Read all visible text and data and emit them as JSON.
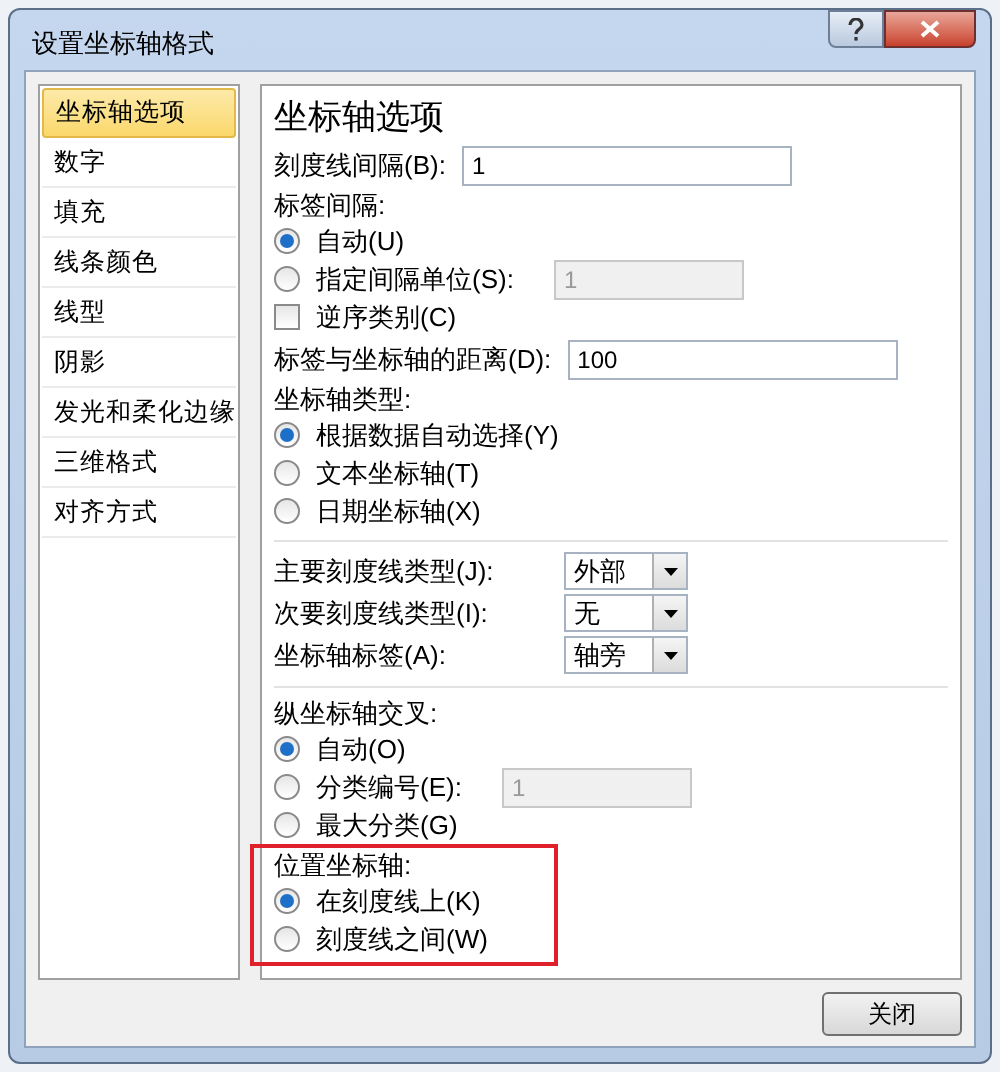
{
  "window": {
    "title": "设置坐标轴格式"
  },
  "sidebar": {
    "items": [
      {
        "label": "坐标轴选项",
        "selected": true
      },
      {
        "label": "数字",
        "selected": false
      },
      {
        "label": "填充",
        "selected": false
      },
      {
        "label": "线条颜色",
        "selected": false
      },
      {
        "label": "线型",
        "selected": false
      },
      {
        "label": "阴影",
        "selected": false
      },
      {
        "label": "发光和柔化边缘",
        "selected": false
      },
      {
        "label": "三维格式",
        "selected": false
      },
      {
        "label": "对齐方式",
        "selected": false
      }
    ]
  },
  "panel": {
    "heading": "坐标轴选项",
    "controls": [
      {
        "kind": "field",
        "label": "刻度线间隔(B):",
        "value": "1",
        "disabled": false
      },
      {
        "kind": "label",
        "label": "标签间隔:"
      },
      {
        "kind": "radio",
        "label": "自动(U)",
        "selected": true
      },
      {
        "kind": "radio",
        "label": "指定间隔单位(S):",
        "selected": false,
        "field": {
          "value": "1",
          "disabled": true
        }
      },
      {
        "kind": "checkbox",
        "label": "逆序类别(C)",
        "checked": false
      },
      {
        "kind": "field",
        "label": "标签与坐标轴的距离(D):",
        "value": "100",
        "disabled": false
      },
      {
        "kind": "label",
        "label": "坐标轴类型:"
      },
      {
        "kind": "radio",
        "label": "根据数据自动选择(Y)",
        "selected": true
      },
      {
        "kind": "radio",
        "label": "文本坐标轴(T)",
        "selected": false
      },
      {
        "kind": "radio",
        "label": "日期坐标轴(X)",
        "selected": false
      },
      {
        "kind": "separator"
      },
      {
        "kind": "select",
        "label": "主要刻度线类型(J):",
        "value": "外部"
      },
      {
        "kind": "select",
        "label": "次要刻度线类型(I):",
        "value": "无"
      },
      {
        "kind": "select",
        "label": "坐标轴标签(A):",
        "value": "轴旁"
      },
      {
        "kind": "separator"
      },
      {
        "kind": "label",
        "label": "纵坐标轴交叉:"
      },
      {
        "kind": "radio",
        "label": "自动(O)",
        "selected": true
      },
      {
        "kind": "radio",
        "label": "分类编号(E):",
        "selected": false,
        "field": {
          "value": "1",
          "disabled": true
        }
      },
      {
        "kind": "radio",
        "label": "最大分类(G)",
        "selected": false
      },
      {
        "kind": "highlight",
        "children": [
          {
            "kind": "label",
            "label": "位置坐标轴:"
          },
          {
            "kind": "radio",
            "label": "在刻度线上(K)",
            "selected": true
          },
          {
            "kind": "radio",
            "label": "刻度线之间(W)",
            "selected": false
          }
        ]
      }
    ]
  },
  "buttons": [
    {
      "label": "关闭"
    }
  ]
}
